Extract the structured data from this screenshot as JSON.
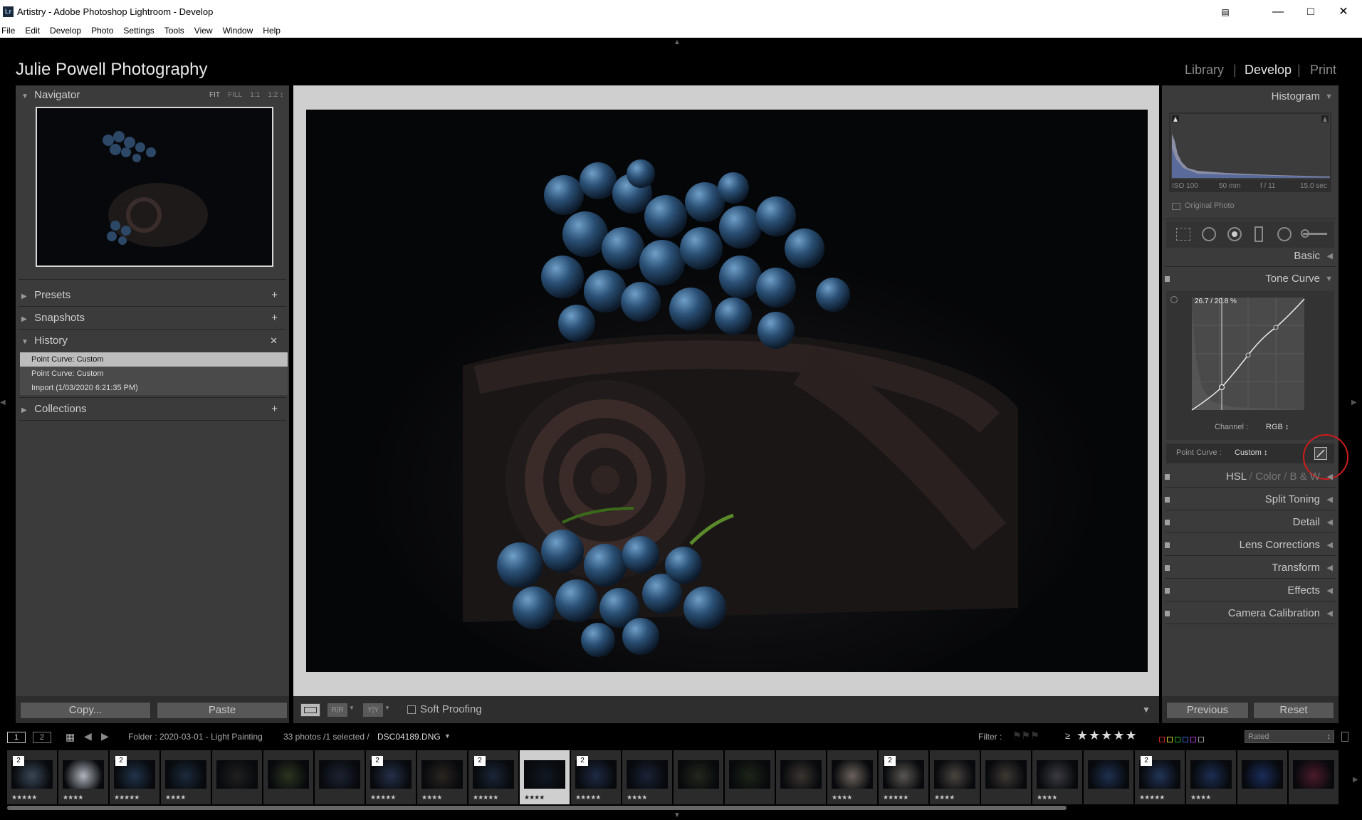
{
  "window": {
    "title": "Artistry - Adobe Photoshop Lightroom - Develop",
    "app_badge": "Lr",
    "controls": [
      "—",
      "□",
      "✕"
    ]
  },
  "menu": [
    "File",
    "Edit",
    "Develop",
    "Photo",
    "Settings",
    "Tools",
    "View",
    "Window",
    "Help"
  ],
  "identity_plate": "Julie Powell Photography",
  "modules": {
    "library": "Library",
    "develop": "Develop",
    "print": "Print"
  },
  "left": {
    "navigator": {
      "title": "Navigator",
      "zooms": [
        "FIT",
        "FILL",
        "1:1",
        "1:2"
      ]
    },
    "presets": "Presets",
    "snapshots": "Snapshots",
    "history": {
      "title": "History",
      "items": [
        "Point Curve: Custom",
        "Point Curve: Custom",
        "Import (1/03/2020 6:21:35 PM)"
      ]
    },
    "collections": "Collections",
    "copy_button": "Copy...",
    "paste_button": "Paste"
  },
  "toolbar": {
    "soft_proofing": "Soft Proofing"
  },
  "right": {
    "histogram": {
      "title": "Histogram",
      "iso": "ISO 100",
      "focal": "50 mm",
      "aperture": "f / 11",
      "shutter": "15.0 sec",
      "original_photo": "Original Photo"
    },
    "basic": "Basic",
    "tone_curve": {
      "title": "Tone Curve",
      "readout": "26.7 / 20.8 %",
      "channel_label": "Channel :",
      "channel_value": "RGB",
      "point_curve_label": "Point Curve :",
      "point_curve_value": "Custom"
    },
    "hsl": {
      "hsl": "HSL",
      "color": "Color",
      "bw": "B & W"
    },
    "split_toning": "Split Toning",
    "detail": "Detail",
    "lens_corrections": "Lens Corrections",
    "transform": "Transform",
    "effects": "Effects",
    "camera_calibration": "Camera Calibration",
    "previous_button": "Previous",
    "reset_button": "Reset"
  },
  "filmbar": {
    "screen1": "1",
    "screen2": "2",
    "folder": "Folder : 2020-03-01 - Light Painting",
    "count": "33 photos /1 selected /",
    "filename": "DSC04189.DNG",
    "filter_label": "Filter :",
    "rating_op": "≥",
    "filter_stars": "★★★★★",
    "filter_preset": "Rated"
  },
  "thumbnails": [
    {
      "stars": "★★★★★",
      "stack": "2",
      "tint": "#3a4656"
    },
    {
      "stars": "★★★★",
      "stack": "",
      "tint": "#b0b4bc"
    },
    {
      "stars": "★★★★★",
      "stack": "2",
      "tint": "#21334a"
    },
    {
      "stars": "★★★★",
      "stack": "",
      "tint": "#1b2a3c"
    },
    {
      "stars": "",
      "stack": "",
      "tint": "#202020"
    },
    {
      "stars": "",
      "stack": "",
      "tint": "#2c3420"
    },
    {
      "stars": "",
      "stack": "",
      "tint": "#1c2232"
    },
    {
      "stars": "★★★★★",
      "stack": "2",
      "tint": "#24304a"
    },
    {
      "stars": "★★★★",
      "stack": "",
      "tint": "#2a2420"
    },
    {
      "stars": "★★★★★",
      "stack": "2",
      "tint": "#1a2638"
    },
    {
      "stars": "★★★★",
      "stack": "",
      "tint": "#101822"
    },
    {
      "stars": "★★★★★",
      "stack": "2",
      "tint": "#1e2a44"
    },
    {
      "stars": "★★★★",
      "stack": "",
      "tint": "#1a2236"
    },
    {
      "stars": "",
      "stack": "",
      "tint": "#22261a"
    },
    {
      "stars": "",
      "stack": "",
      "tint": "#1e2418"
    },
    {
      "stars": "",
      "stack": "",
      "tint": "#3a3430"
    },
    {
      "stars": "★★★★",
      "stack": "",
      "tint": "#6a625a"
    },
    {
      "stars": "★★★★★",
      "stack": "2",
      "tint": "#5a5652"
    },
    {
      "stars": "★★★★",
      "stack": "",
      "tint": "#4a4440"
    },
    {
      "stars": "",
      "stack": "",
      "tint": "#3e3834"
    },
    {
      "stars": "★★★★",
      "stack": "",
      "tint": "#3a3a40"
    },
    {
      "stars": "",
      "stack": "",
      "tint": "#1e3050"
    },
    {
      "stars": "★★★★★",
      "stack": "2",
      "tint": "#223456"
    },
    {
      "stars": "★★★★",
      "stack": "",
      "tint": "#1c2e52"
    },
    {
      "stars": "",
      "stack": "",
      "tint": "#1a2c5a"
    },
    {
      "stars": "",
      "stack": "",
      "tint": "#4a1a2a"
    }
  ]
}
